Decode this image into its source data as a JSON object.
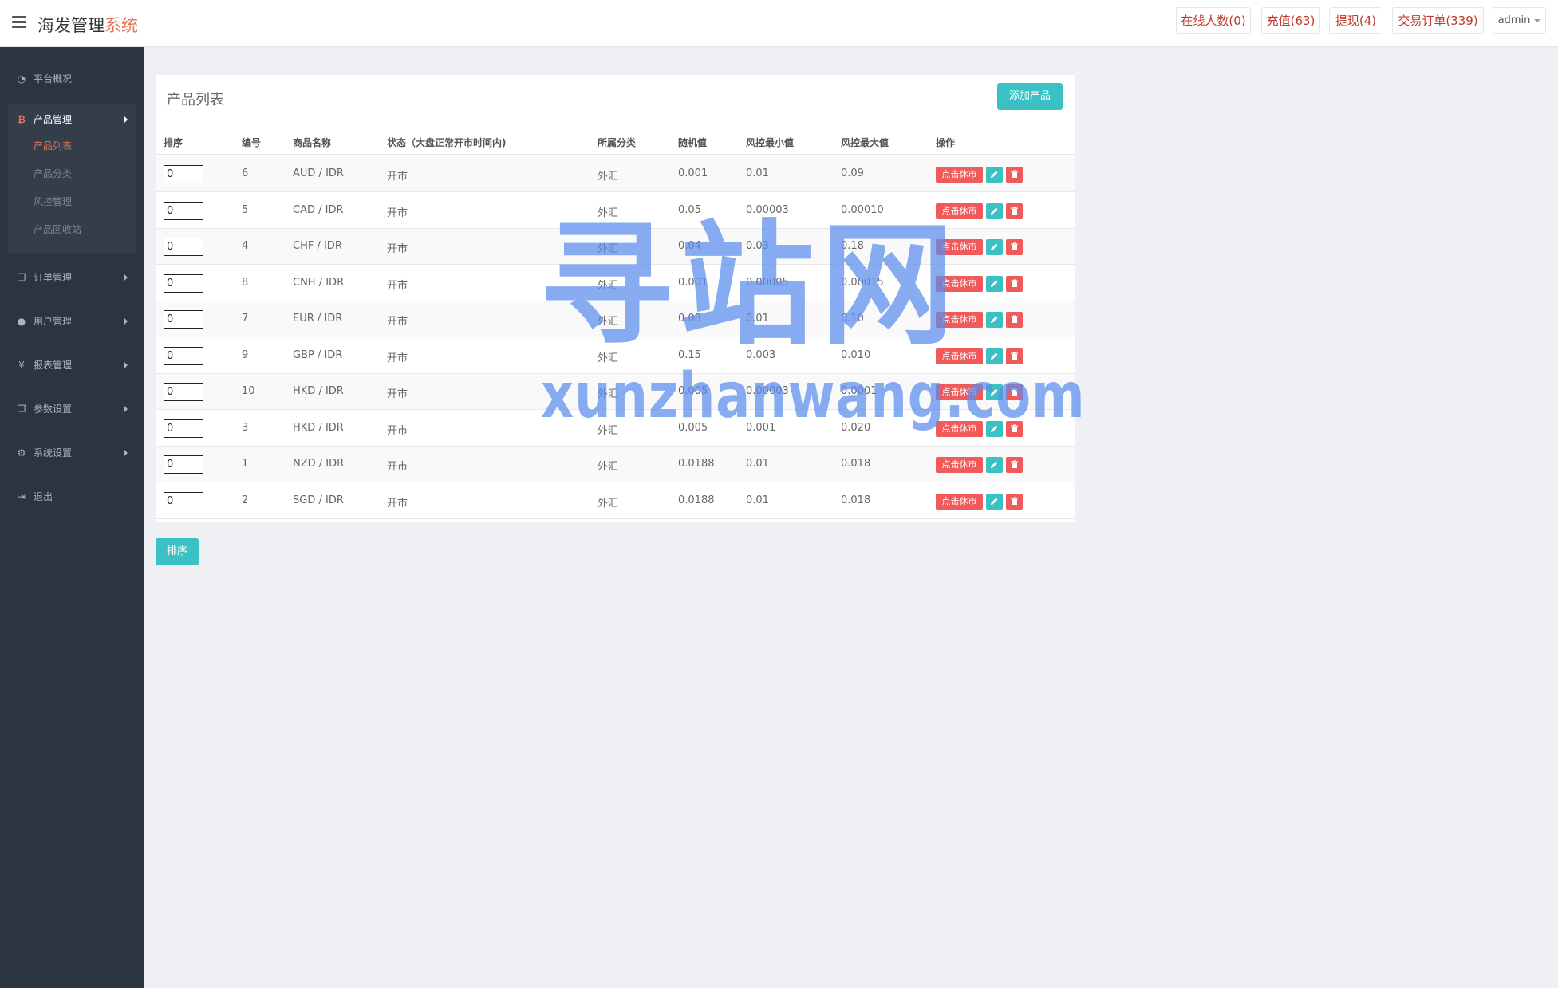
{
  "header": {
    "brand_main": "海发管理",
    "brand_accent": "系统",
    "online": "在线人数(0)",
    "recharge": "充值(63)",
    "withdraw": "提现(4)",
    "orders": "交易订单(339)",
    "user": "admin"
  },
  "sidebar": {
    "overview": "平台概况",
    "product_mgmt": "产品管理",
    "sub": [
      "产品列表",
      "产品分类",
      "风控管理",
      "产品回收站"
    ],
    "order_mgmt": "订单管理",
    "user_mgmt": "用户管理",
    "report_mgmt": "报表管理",
    "param_settings": "参数设置",
    "system_settings": "系统设置",
    "logout": "退出"
  },
  "panel": {
    "title": "产品列表",
    "add_button": "添加产品",
    "headers": [
      "排序",
      "编号",
      "商品名称",
      "状态（大盘正常开市时间内)",
      "所属分类",
      "随机值",
      "风控最小值",
      "风控最大值",
      "操作"
    ],
    "close_button": "点击休市",
    "rows": [
      {
        "sort": "0",
        "id": "6",
        "name": "AUD / IDR",
        "status": "开市",
        "category": "外汇",
        "random": "0.001",
        "min": "0.01",
        "max": "0.09"
      },
      {
        "sort": "0",
        "id": "5",
        "name": "CAD / IDR",
        "status": "开市",
        "category": "外汇",
        "random": "0.05",
        "min": "0.00003",
        "max": "0.00010"
      },
      {
        "sort": "0",
        "id": "4",
        "name": "CHF / IDR",
        "status": "开市",
        "category": "外汇",
        "random": "0.04",
        "min": "0.03",
        "max": "0.18"
      },
      {
        "sort": "0",
        "id": "8",
        "name": "CNH / IDR",
        "status": "开市",
        "category": "外汇",
        "random": "0.001",
        "min": "0.00005",
        "max": "0.00015"
      },
      {
        "sort": "0",
        "id": "7",
        "name": "EUR / IDR",
        "status": "开市",
        "category": "外汇",
        "random": "0.08",
        "min": "0.01",
        "max": "0.10"
      },
      {
        "sort": "0",
        "id": "9",
        "name": "GBP / IDR",
        "status": "开市",
        "category": "外汇",
        "random": "0.15",
        "min": "0.003",
        "max": "0.010"
      },
      {
        "sort": "0",
        "id": "10",
        "name": "HKD / IDR",
        "status": "开市",
        "category": "外汇",
        "random": "0.005",
        "min": "0.00003",
        "max": "0.0001"
      },
      {
        "sort": "0",
        "id": "3",
        "name": "HKD / IDR",
        "status": "开市",
        "category": "外汇",
        "random": "0.005",
        "min": "0.001",
        "max": "0.020"
      },
      {
        "sort": "0",
        "id": "1",
        "name": "NZD / IDR",
        "status": "开市",
        "category": "外汇",
        "random": "0.0188",
        "min": "0.01",
        "max": "0.018"
      },
      {
        "sort": "0",
        "id": "2",
        "name": "SGD / IDR",
        "status": "开市",
        "category": "外汇",
        "random": "0.0188",
        "min": "0.01",
        "max": "0.018"
      }
    ],
    "sort_button": "排序"
  },
  "watermark": {
    "cn": "寻站网",
    "en": "xunzhanwang.com"
  }
}
